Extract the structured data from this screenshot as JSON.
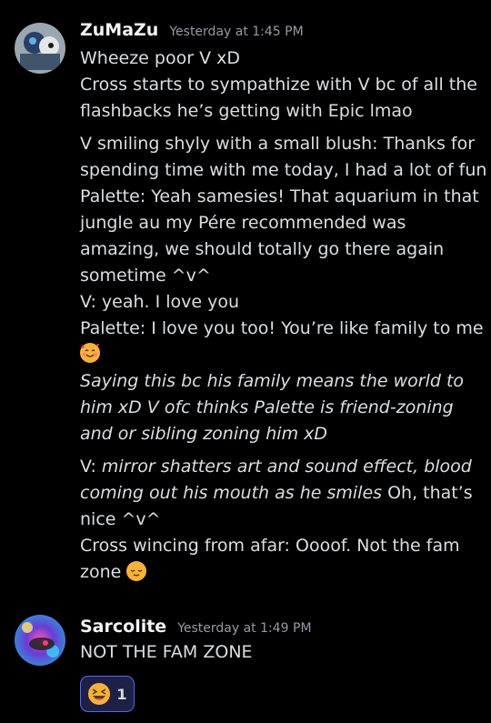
{
  "messages": [
    {
      "username": "ZuMaZu",
      "timestamp": "Yesterday at 1:45 PM",
      "avatar_icon": "avatar-zumazu-icon",
      "lines": [
        "Wheeze poor V xD",
        "Cross starts to sympathize with V bc of all the",
        "flashbacks he’s getting with Epic lmao",
        "V smiling shyly with a small blush: Thanks for",
        "spending time with me today, I had a lot of fun",
        "Palette: Yeah samesies! That aquarium in that",
        "jungle au my Pére recommended was",
        "amazing, we should totally go there again",
        "sometime ^v^",
        "V: yeah. I love you",
        "Palette: I love you too! You’re like family to me",
        "Saying this bc his family means the world to",
        "him xD V ofc thinks Palette is friend-zoning",
        "and or sibling zoning him xD",
        "V: ",
        "mirror shatters art and sound effect, blood",
        "coming out his mouth as he smiles",
        " Oh, that’s",
        "nice ^v^",
        "Cross wincing from afar: Oooof. Not the fam",
        "zone"
      ],
      "emoji_love": "smiling-face-with-hearts-icon",
      "emoji_relieved": "relieved-face-icon"
    },
    {
      "username": "Sarcolite",
      "timestamp": "Yesterday at 1:49 PM",
      "avatar_icon": "avatar-sarcolite-icon",
      "lines": [
        "NOT THE FAM ZONE"
      ],
      "reaction": {
        "emoji": "laughing-face-icon",
        "count": "1"
      }
    }
  ],
  "colors": {
    "background": "#000000",
    "username": "#f2f3f5",
    "text": "#dbdee1",
    "timestamp": "#949ba4",
    "reaction_border": "#5865f2"
  }
}
